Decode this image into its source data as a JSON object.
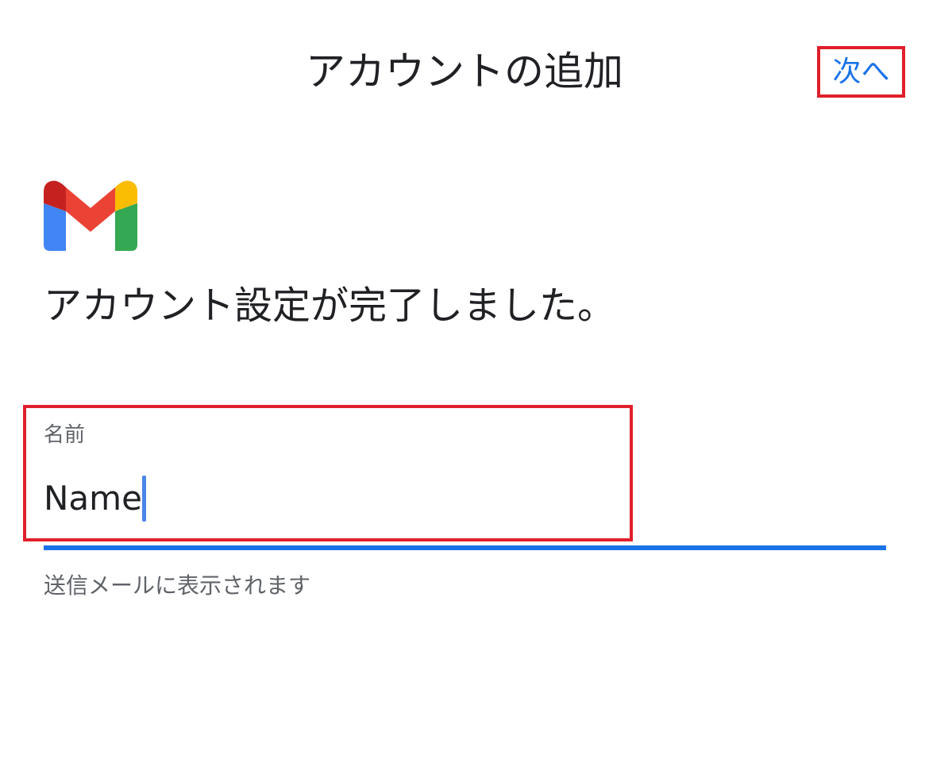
{
  "header": {
    "title": "アカウントの追加",
    "next_label": "次へ"
  },
  "content": {
    "logo_icon": "gmail-logo-icon",
    "headline": "アカウント設定が完了しました。"
  },
  "name_field": {
    "label": "名前",
    "value": "Name",
    "helper": "送信メールに表示されます"
  },
  "colors": {
    "accent": "#1a73e8",
    "highlight_border": "#e0202b",
    "text_primary": "#202124",
    "text_secondary": "#5f6368"
  }
}
